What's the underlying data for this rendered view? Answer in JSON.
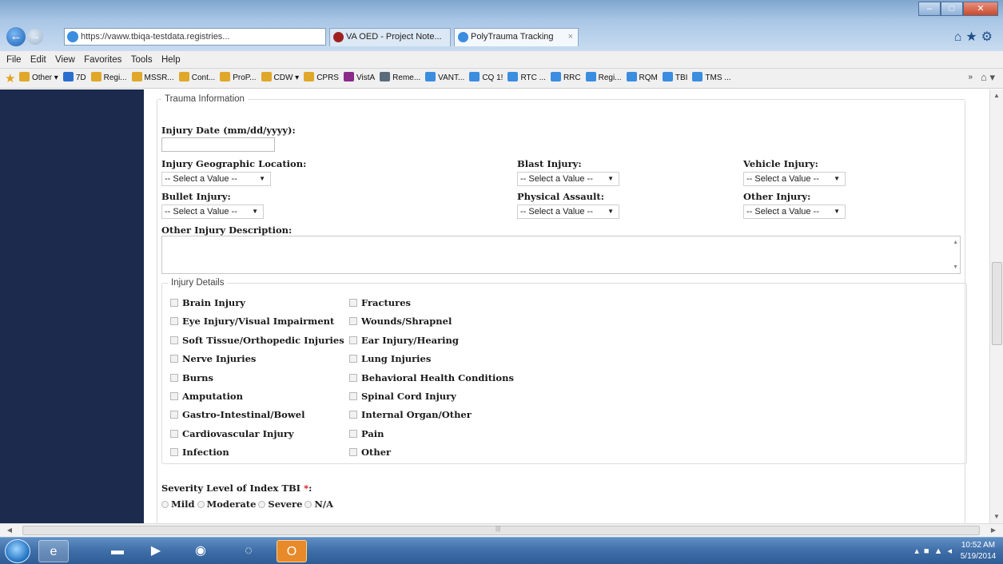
{
  "browser": {
    "address": "https://vaww.tbiqa-testdata.registries...",
    "tabs": [
      {
        "label": "VA OED - Project Note..."
      },
      {
        "label": "PolyTrauma Tracking"
      }
    ],
    "menu": [
      "File",
      "Edit",
      "View",
      "Favorites",
      "Tools",
      "Help"
    ],
    "favorites": [
      {
        "label": "Other ▾",
        "color": "#e0a82a"
      },
      {
        "label": "7D",
        "color": "#2a6fd0"
      },
      {
        "label": "Regi...",
        "color": "#e0a82a"
      },
      {
        "label": "MSSR...",
        "color": "#e0a82a"
      },
      {
        "label": "Cont...",
        "color": "#e0a82a"
      },
      {
        "label": "ProP...",
        "color": "#e0a82a"
      },
      {
        "label": "CDW ▾",
        "color": "#e0a82a"
      },
      {
        "label": "CPRS",
        "color": "#e0a82a"
      },
      {
        "label": "VistA",
        "color": "#8a2b8a"
      },
      {
        "label": "Reme...",
        "color": "#5a6c7c"
      },
      {
        "label": "VANT...",
        "color": "#3b8de0"
      },
      {
        "label": "CQ 1!",
        "color": "#3b8de0"
      },
      {
        "label": "RTC ...",
        "color": "#3b8de0"
      },
      {
        "label": "RRC",
        "color": "#3b8de0"
      },
      {
        "label": "Regi...",
        "color": "#3b8de0"
      },
      {
        "label": "RQM",
        "color": "#3b8de0"
      },
      {
        "label": "TBI",
        "color": "#3b8de0"
      },
      {
        "label": "TMS ...",
        "color": "#3b8de0"
      }
    ],
    "fav_more": "»"
  },
  "form": {
    "trauma_legend": "Trauma Information",
    "injury_date_label": "Injury Date (mm/dd/yyyy):",
    "select_placeholder": "-- Select a Value --",
    "fields": {
      "geo_location": "Injury Geographic Location:",
      "blast_injury": "Blast Injury:",
      "vehicle_injury": "Vehicle Injury:",
      "bullet_injury": "Bullet Injury:",
      "physical_assault": "Physical Assault:",
      "other_injury": "Other Injury:"
    },
    "other_desc_label": "Other Injury Description:",
    "injury_details_legend": "Injury Details",
    "details_left": [
      "Brain Injury",
      "Eye Injury/Visual Impairment",
      "Soft Tissue/Orthopedic Injuries",
      "Nerve Injuries",
      "Burns",
      "Amputation",
      "Gastro-Intestinal/Bowel",
      "Cardiovascular Injury",
      "Infection"
    ],
    "details_right": [
      "Fractures",
      "Wounds/Shrapnel",
      "Ear Injury/Hearing",
      "Lung Injuries",
      "Behavioral Health Conditions",
      "Spinal Cord Injury",
      "Internal Organ/Other",
      "Pain",
      "Other"
    ],
    "severity_label": "Severity Level of Index TBI",
    "required_mark": "*",
    "severity_colon": ":",
    "severity_options": [
      "Mild",
      "Moderate",
      "Severe",
      "N/A"
    ]
  },
  "taskbar": {
    "time": "10:52 AM",
    "date": "5/19/2014"
  },
  "colors": {
    "sidebar": "#1c2b4d",
    "required": "#d01010"
  }
}
